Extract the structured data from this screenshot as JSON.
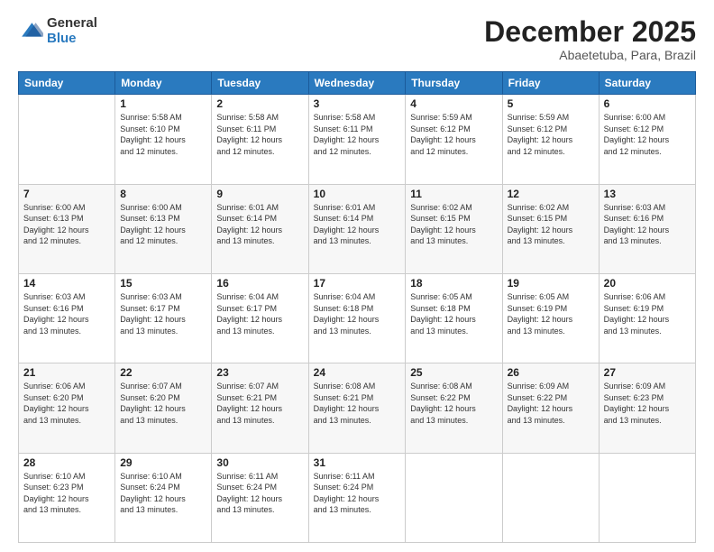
{
  "header": {
    "logo_general": "General",
    "logo_blue": "Blue",
    "month_title": "December 2025",
    "subtitle": "Abaetetuba, Para, Brazil"
  },
  "calendar": {
    "days_of_week": [
      "Sunday",
      "Monday",
      "Tuesday",
      "Wednesday",
      "Thursday",
      "Friday",
      "Saturday"
    ],
    "weeks": [
      [
        {
          "day": "",
          "info": ""
        },
        {
          "day": "1",
          "info": "Sunrise: 5:58 AM\nSunset: 6:10 PM\nDaylight: 12 hours\nand 12 minutes."
        },
        {
          "day": "2",
          "info": "Sunrise: 5:58 AM\nSunset: 6:11 PM\nDaylight: 12 hours\nand 12 minutes."
        },
        {
          "day": "3",
          "info": "Sunrise: 5:58 AM\nSunset: 6:11 PM\nDaylight: 12 hours\nand 12 minutes."
        },
        {
          "day": "4",
          "info": "Sunrise: 5:59 AM\nSunset: 6:12 PM\nDaylight: 12 hours\nand 12 minutes."
        },
        {
          "day": "5",
          "info": "Sunrise: 5:59 AM\nSunset: 6:12 PM\nDaylight: 12 hours\nand 12 minutes."
        },
        {
          "day": "6",
          "info": "Sunrise: 6:00 AM\nSunset: 6:12 PM\nDaylight: 12 hours\nand 12 minutes."
        }
      ],
      [
        {
          "day": "7",
          "info": "Sunrise: 6:00 AM\nSunset: 6:13 PM\nDaylight: 12 hours\nand 12 minutes."
        },
        {
          "day": "8",
          "info": "Sunrise: 6:00 AM\nSunset: 6:13 PM\nDaylight: 12 hours\nand 12 minutes."
        },
        {
          "day": "9",
          "info": "Sunrise: 6:01 AM\nSunset: 6:14 PM\nDaylight: 12 hours\nand 13 minutes."
        },
        {
          "day": "10",
          "info": "Sunrise: 6:01 AM\nSunset: 6:14 PM\nDaylight: 12 hours\nand 13 minutes."
        },
        {
          "day": "11",
          "info": "Sunrise: 6:02 AM\nSunset: 6:15 PM\nDaylight: 12 hours\nand 13 minutes."
        },
        {
          "day": "12",
          "info": "Sunrise: 6:02 AM\nSunset: 6:15 PM\nDaylight: 12 hours\nand 13 minutes."
        },
        {
          "day": "13",
          "info": "Sunrise: 6:03 AM\nSunset: 6:16 PM\nDaylight: 12 hours\nand 13 minutes."
        }
      ],
      [
        {
          "day": "14",
          "info": "Sunrise: 6:03 AM\nSunset: 6:16 PM\nDaylight: 12 hours\nand 13 minutes."
        },
        {
          "day": "15",
          "info": "Sunrise: 6:03 AM\nSunset: 6:17 PM\nDaylight: 12 hours\nand 13 minutes."
        },
        {
          "day": "16",
          "info": "Sunrise: 6:04 AM\nSunset: 6:17 PM\nDaylight: 12 hours\nand 13 minutes."
        },
        {
          "day": "17",
          "info": "Sunrise: 6:04 AM\nSunset: 6:18 PM\nDaylight: 12 hours\nand 13 minutes."
        },
        {
          "day": "18",
          "info": "Sunrise: 6:05 AM\nSunset: 6:18 PM\nDaylight: 12 hours\nand 13 minutes."
        },
        {
          "day": "19",
          "info": "Sunrise: 6:05 AM\nSunset: 6:19 PM\nDaylight: 12 hours\nand 13 minutes."
        },
        {
          "day": "20",
          "info": "Sunrise: 6:06 AM\nSunset: 6:19 PM\nDaylight: 12 hours\nand 13 minutes."
        }
      ],
      [
        {
          "day": "21",
          "info": "Sunrise: 6:06 AM\nSunset: 6:20 PM\nDaylight: 12 hours\nand 13 minutes."
        },
        {
          "day": "22",
          "info": "Sunrise: 6:07 AM\nSunset: 6:20 PM\nDaylight: 12 hours\nand 13 minutes."
        },
        {
          "day": "23",
          "info": "Sunrise: 6:07 AM\nSunset: 6:21 PM\nDaylight: 12 hours\nand 13 minutes."
        },
        {
          "day": "24",
          "info": "Sunrise: 6:08 AM\nSunset: 6:21 PM\nDaylight: 12 hours\nand 13 minutes."
        },
        {
          "day": "25",
          "info": "Sunrise: 6:08 AM\nSunset: 6:22 PM\nDaylight: 12 hours\nand 13 minutes."
        },
        {
          "day": "26",
          "info": "Sunrise: 6:09 AM\nSunset: 6:22 PM\nDaylight: 12 hours\nand 13 minutes."
        },
        {
          "day": "27",
          "info": "Sunrise: 6:09 AM\nSunset: 6:23 PM\nDaylight: 12 hours\nand 13 minutes."
        }
      ],
      [
        {
          "day": "28",
          "info": "Sunrise: 6:10 AM\nSunset: 6:23 PM\nDaylight: 12 hours\nand 13 minutes."
        },
        {
          "day": "29",
          "info": "Sunrise: 6:10 AM\nSunset: 6:24 PM\nDaylight: 12 hours\nand 13 minutes."
        },
        {
          "day": "30",
          "info": "Sunrise: 6:11 AM\nSunset: 6:24 PM\nDaylight: 12 hours\nand 13 minutes."
        },
        {
          "day": "31",
          "info": "Sunrise: 6:11 AM\nSunset: 6:24 PM\nDaylight: 12 hours\nand 13 minutes."
        },
        {
          "day": "",
          "info": ""
        },
        {
          "day": "",
          "info": ""
        },
        {
          "day": "",
          "info": ""
        }
      ]
    ]
  }
}
